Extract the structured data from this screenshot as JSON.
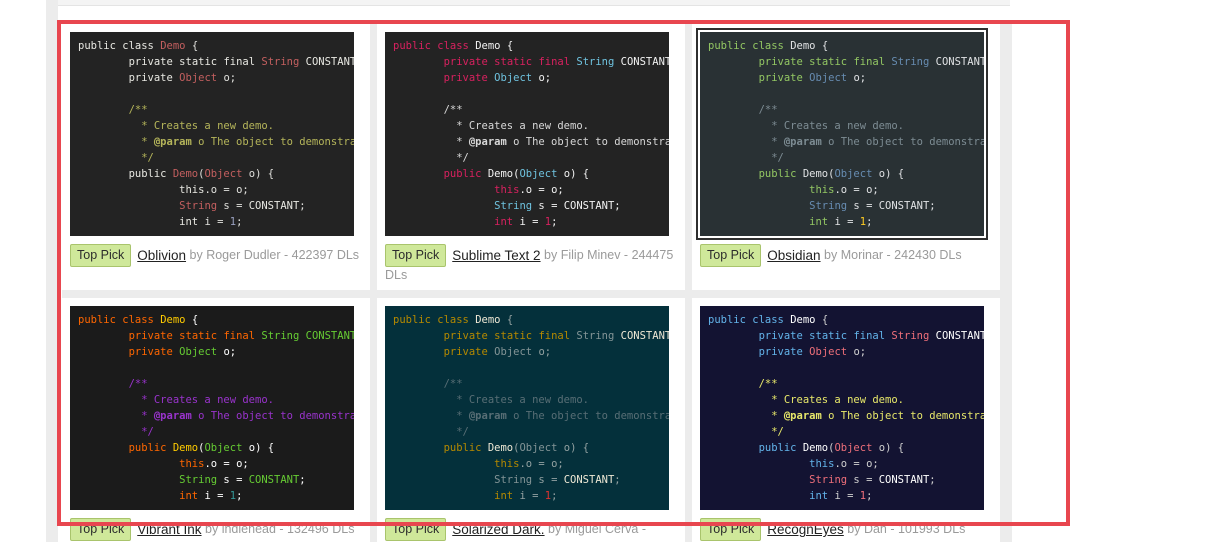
{
  "page": {
    "background": "#ececec",
    "selection_border_color": "#e8464f",
    "badge_label": "Top Pick",
    "badge_bg": "#cfe89a"
  },
  "code_lines": [
    "public class Demo {",
    "        private static final String CONSTANT",
    "        private Object o;",
    "",
    "        /**",
    "          * Creates a new demo.",
    "          * @param o The object to demonstrat",
    "          */",
    "        public Demo(Object o) {",
    "                this.o = o;",
    "                String s = CONSTANT;",
    "                int i = 1;"
  ],
  "themes": [
    {
      "id": "oblivion",
      "name": "Oblivion",
      "author": "Roger Dudler",
      "downloads": "422397",
      "caption_suffix": "DLs",
      "by_text": "by Roger Dudler - 422397 DLs",
      "selected": false,
      "bg": "#232323",
      "colors": {
        "default": "#e0e0dc",
        "keyword": "#e8e8e2",
        "type": "#c35f5f",
        "classname": "#c35f5f",
        "comment": "#b5b55a",
        "constant": "#e8e8e2",
        "punct": "#e8e8e2",
        "literal": "#9aa0c0"
      }
    },
    {
      "id": "sublime-text-2",
      "name": "Sublime Text 2",
      "author": "Filip Minev",
      "downloads": "244475",
      "caption_suffix": "DLs",
      "by_text": "by Filip Minev - 244475 DLs",
      "selected": false,
      "bg": "#232323",
      "colors": {
        "default": "#f2f2f2",
        "keyword": "#d8215f",
        "type": "#6fc3df",
        "classname": "#f2f2f2",
        "comment": "#d8d8d8",
        "constant": "#f2f2f2",
        "punct": "#f2f2f2",
        "literal": "#d8215f"
      }
    },
    {
      "id": "obsidian",
      "name": "Obsidian",
      "author": "Morinar",
      "downloads": "242430",
      "caption_suffix": "DLs",
      "by_text": "by Morinar - 242430 DLs",
      "selected": true,
      "bg": "#293134",
      "colors": {
        "default": "#e0e2e4",
        "keyword": "#93c763",
        "type": "#678cb1",
        "classname": "#e0e2e4",
        "comment": "#7d8c93",
        "constant": "#e0e2e4",
        "punct": "#e8e2b7",
        "literal": "#ffcd22"
      }
    },
    {
      "id": "vibrant-ink",
      "name": "Vibrant Ink",
      "author": "indiehead",
      "downloads": "132496",
      "caption_suffix": "DLs",
      "by_text": "by indiehead - 132496 DLs",
      "selected": false,
      "bg": "#1b1b1b",
      "colors": {
        "default": "#ffffff",
        "keyword": "#ff6600",
        "type": "#66cc33",
        "classname": "#ffcc00",
        "comment": "#9933cc",
        "constant": "#66cc33",
        "punct": "#ffffff",
        "literal": "#339999"
      }
    },
    {
      "id": "solarized-dark",
      "name": "Solarized Dark.",
      "author": "Miguel Cerva",
      "downloads": "",
      "caption_suffix": "",
      "by_text": "by Miguel Cerva -",
      "selected": false,
      "bg": "#04303b",
      "colors": {
        "default": "#93a1a1",
        "keyword": "#b58900",
        "type": "#839496",
        "classname": "#eee8d5",
        "comment": "#586e75",
        "constant": "#eee8d5",
        "punct": "#93a1a1",
        "literal": "#dc322f"
      }
    },
    {
      "id": "recogneyes",
      "name": "RecognEyes",
      "author": "Dan",
      "downloads": "101993",
      "caption_suffix": "DLs",
      "by_text": "by Dan - 101993 DLs",
      "selected": false,
      "bg": "#131332",
      "colors": {
        "default": "#d0d0d0",
        "keyword": "#63b4ea",
        "type": "#ee6f7a",
        "classname": "#ffffff",
        "comment": "#e8e86a",
        "constant": "#ffffff",
        "punct": "#d0d0d0",
        "literal": "#ee6f7a"
      }
    }
  ]
}
